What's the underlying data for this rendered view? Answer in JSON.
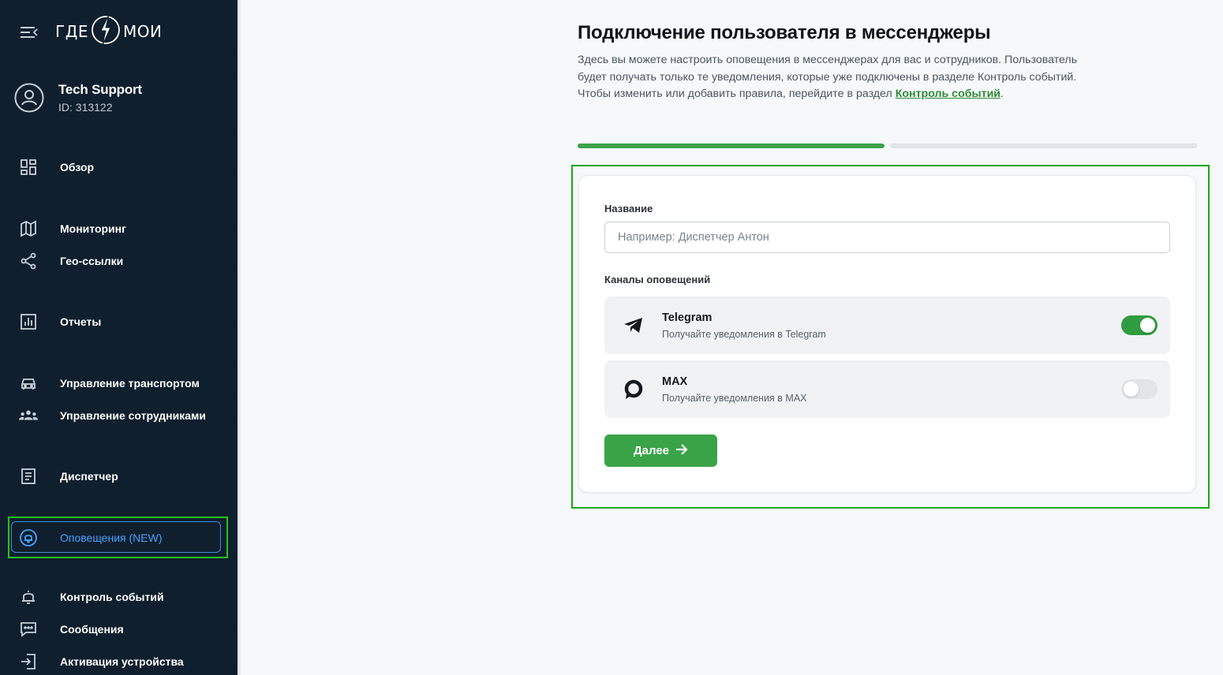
{
  "sidebar": {
    "logo_left": "ГДЕ",
    "logo_right": "МОИ",
    "user": {
      "name": "Tech Support",
      "id": "ID: 313122"
    },
    "items": [
      {
        "label": "Обзор",
        "icon": "dashboard-icon"
      },
      {
        "label": "Мониторинг",
        "icon": "map-icon"
      },
      {
        "label": "Гео-ссылки",
        "icon": "share-icon"
      },
      {
        "label": "Отчеты",
        "icon": "chart-icon"
      },
      {
        "label": "Управление транспортом",
        "icon": "car-icon"
      },
      {
        "label": "Управление сотрудниками",
        "icon": "people-icon"
      },
      {
        "label": "Диспетчер",
        "icon": "document-icon"
      },
      {
        "label": "Оповещения (NEW)",
        "icon": "notification-circle-icon",
        "active": true
      },
      {
        "label": "Контроль событий",
        "icon": "bell-icon"
      },
      {
        "label": "Сообщения",
        "icon": "chat-icon"
      },
      {
        "label": "Активация устройства",
        "icon": "login-icon"
      }
    ]
  },
  "main": {
    "title": "Подключение пользователя в мессенджеры",
    "description": "Здесь вы можете настроить оповещения в мессенджерах для вас и сотрудников. Пользователь будет получать только те уведомления, которые уже подключены в разделе Контроль событий. Чтобы изменить или добавить правила, перейдите в раздел ",
    "description_link": "Контроль событий",
    "description_end": ".",
    "progress": {
      "step": 1,
      "total": 2
    },
    "form": {
      "name_label": "Название",
      "name_placeholder": "Например: Диспетчер Антон",
      "name_value": "",
      "channels_label": "Каналы оповещений",
      "channels": [
        {
          "name": "Telegram",
          "subtitle": "Получайте уведомления в Telegram",
          "enabled": true,
          "icon": "telegram-icon"
        },
        {
          "name": "MAX",
          "subtitle": "Получайте уведомления в MAX",
          "enabled": false,
          "icon": "max-icon"
        }
      ],
      "next_label": "Далее"
    }
  },
  "colors": {
    "sidebar_bg": "#0f1f2e",
    "accent_green": "#3aa348",
    "active_blue": "#4aa3ff",
    "highlight_green": "#1aa51a"
  }
}
